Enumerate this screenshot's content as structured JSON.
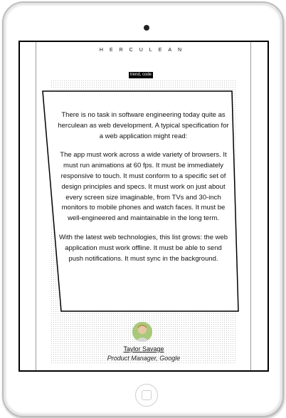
{
  "site": {
    "brand": "HERCULEAN",
    "tag": "trend, code"
  },
  "quote": {
    "paragraphs": [
      "There is no task in software engineering today quite as herculean as web development. A typical specification for a web application might read:",
      "The app must work across a wide variety of browsers. It must run animations at 60 fps. It must be immediately responsive to touch. It must conform to a specific set of design principles and specs. It must work on just about every screen size imaginable, from TVs and 30-inch monitors to mobile phones and watch faces. It must be well-engineered and maintainable in the long term.",
      "With the latest web technologies, this list grows: the web application must work offline. It must be able to send push notifications. It must sync in the background."
    ]
  },
  "author": {
    "name": "Taylor Savage",
    "role": "Product Manager, Google"
  },
  "icons": {
    "camera": "camera-icon",
    "home": "home-button-icon",
    "avatar": "avatar-photo"
  }
}
